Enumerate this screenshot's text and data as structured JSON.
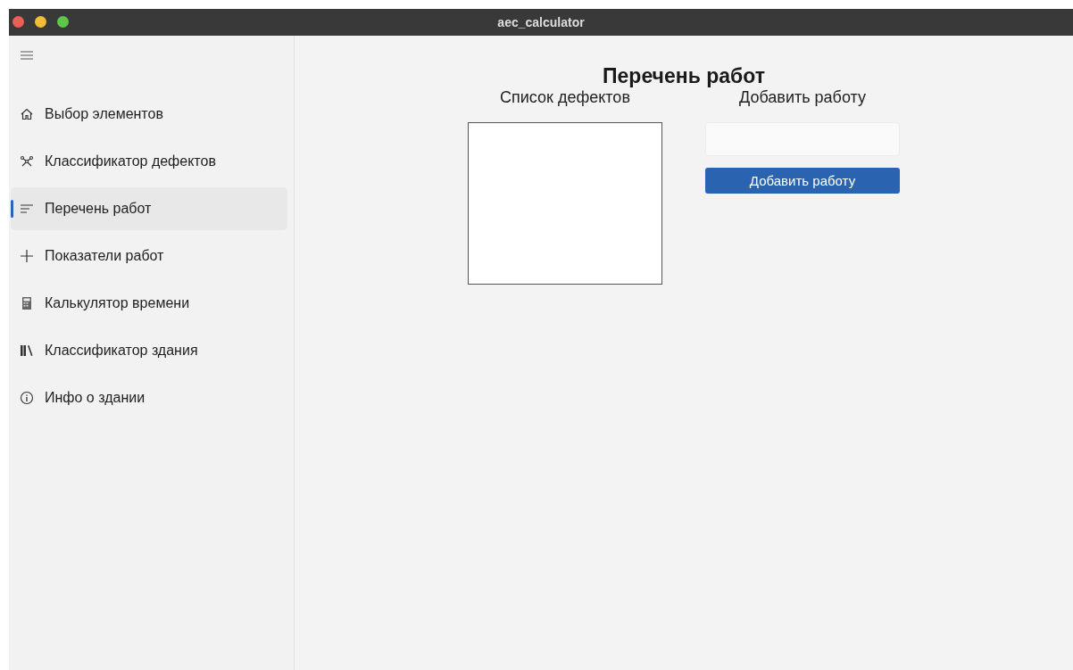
{
  "window": {
    "title": "aec_calculator"
  },
  "sidebar": {
    "items": [
      {
        "label": "Выбор элементов",
        "selected": false
      },
      {
        "label": "Классификатор дефектов",
        "selected": false
      },
      {
        "label": "Перечень работ",
        "selected": true
      },
      {
        "label": "Показатели работ",
        "selected": false
      },
      {
        "label": "Калькулятор времени",
        "selected": false
      },
      {
        "label": "Классификатор здания",
        "selected": false
      },
      {
        "label": "Инфо о здании",
        "selected": false
      }
    ]
  },
  "main": {
    "title": "Перечень работ",
    "defects": {
      "label": "Список дефектов"
    },
    "add": {
      "label": "Добавить работу",
      "button": "Добавить работу"
    }
  }
}
